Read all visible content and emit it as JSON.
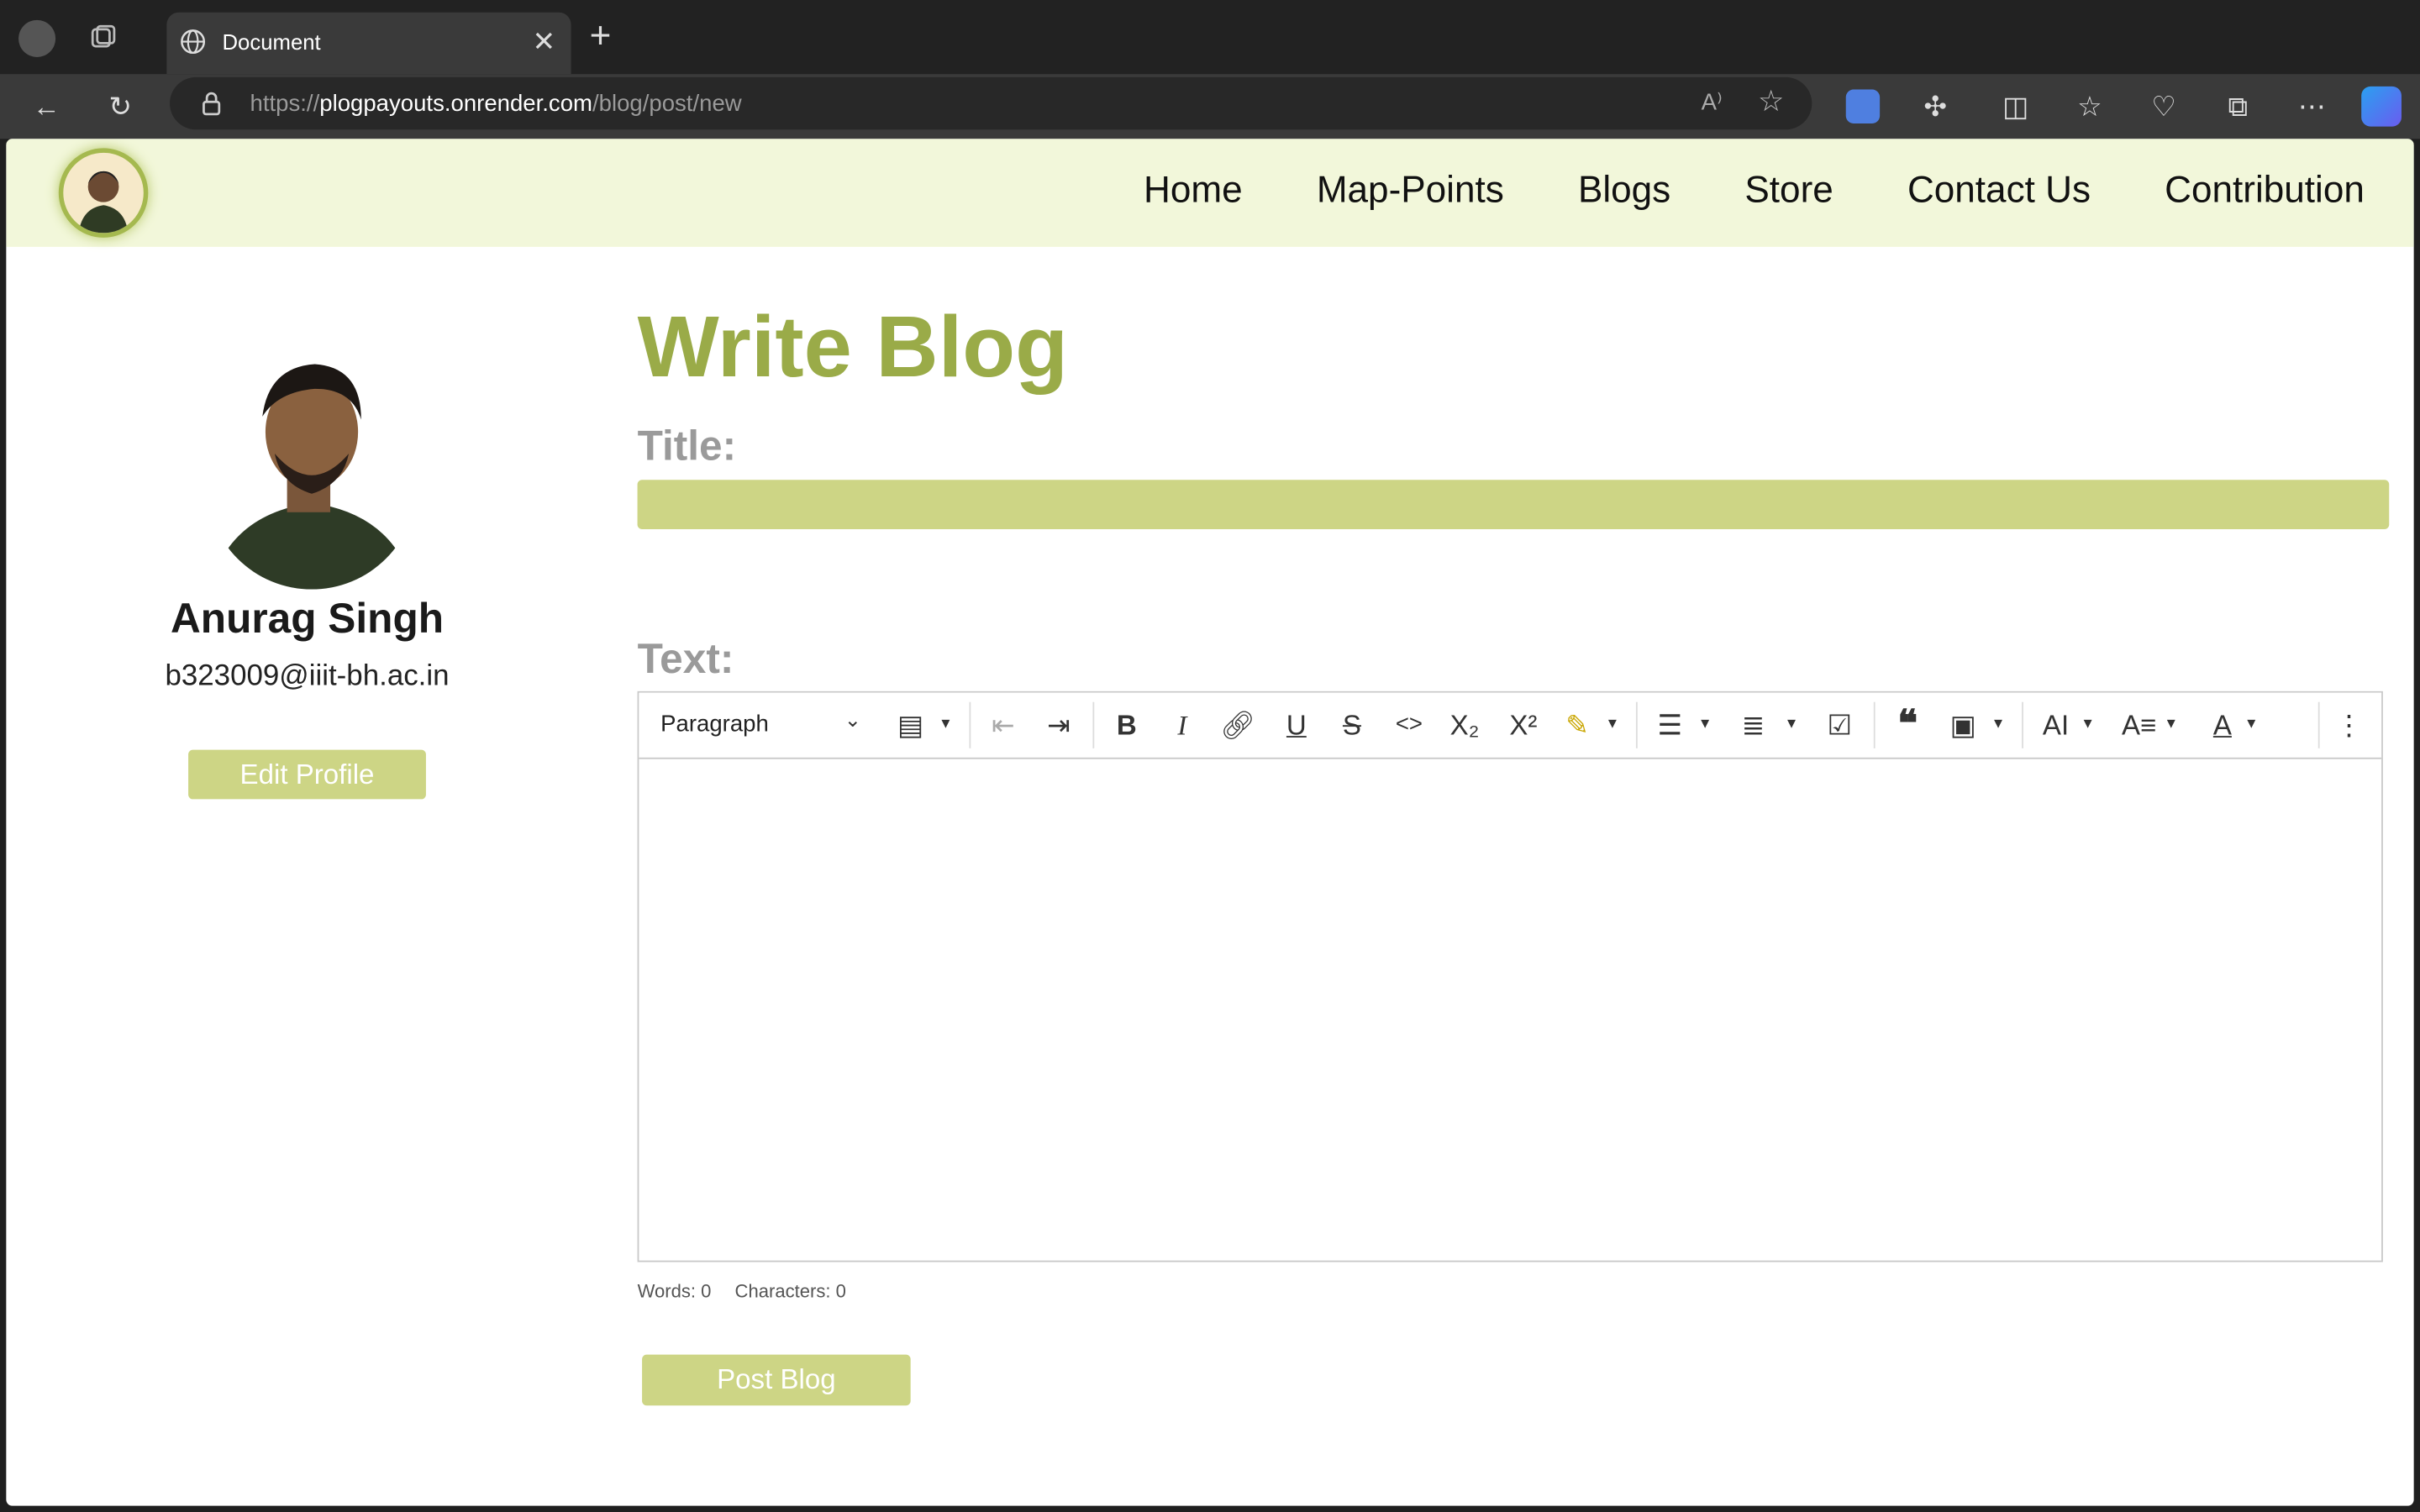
{
  "browser": {
    "tab_title": "Document",
    "url_scheme": "https://",
    "url_host": "plogpayouts.onrender.com",
    "url_path": "/blog/post/new",
    "read_aloud_label": "A⁾"
  },
  "nav": {
    "links": [
      "Home",
      "Map-Points",
      "Blogs",
      "Store",
      "Contact Us",
      "Contribution"
    ]
  },
  "profile": {
    "name": "Anurag Singh",
    "email": "b323009@iiit-bh.ac.in",
    "edit_label": "Edit Profile"
  },
  "form": {
    "page_title": "Write Blog",
    "title_label": "Title:",
    "title_value": "",
    "text_label": "Text:",
    "heading_select": "Paragraph",
    "words": "Words: 0",
    "characters": "Characters: 0",
    "submit_label": "Post Blog"
  },
  "colors": {
    "accent": "#9aab48",
    "input_bg": "#cdd585",
    "nav_bg": "#f2f7da"
  }
}
